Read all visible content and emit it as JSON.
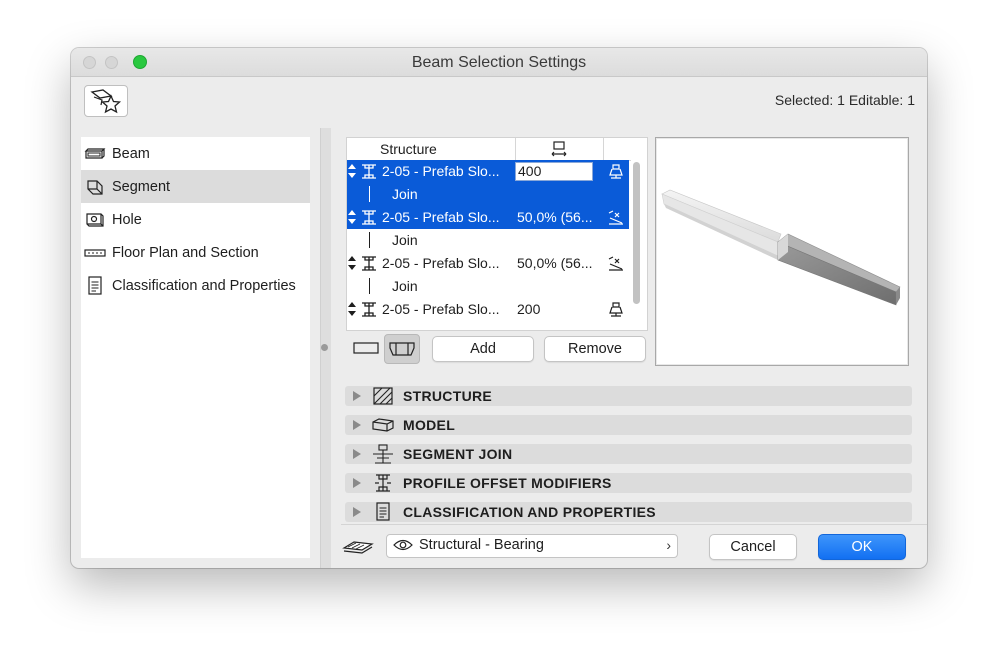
{
  "window": {
    "title": "Beam Selection Settings"
  },
  "header": {
    "selection_info": "Selected: 1 Editable: 1"
  },
  "sidebar": {
    "items": [
      {
        "label": "Beam",
        "icon": "beam-icon"
      },
      {
        "label": "Segment",
        "icon": "segment-icon",
        "selected": true
      },
      {
        "label": "Hole",
        "icon": "hole-icon"
      },
      {
        "label": "Floor Plan and Section",
        "icon": "floor-plan-icon"
      },
      {
        "label": "Classification and Properties",
        "icon": "classification-icon"
      }
    ]
  },
  "segments_table": {
    "columns": [
      "Structure",
      "",
      ""
    ],
    "rows": [
      {
        "type": "segment",
        "name": "2-05 - Prefab Slo...",
        "value": "400",
        "editing": true,
        "selected": true
      },
      {
        "type": "join",
        "label": "Join",
        "selected": true
      },
      {
        "type": "segment",
        "name": "2-05 - Prefab Slo...",
        "value": "50,0% (56...",
        "selected": true
      },
      {
        "type": "join",
        "label": "Join",
        "selected": false
      },
      {
        "type": "segment",
        "name": "2-05 - Prefab Slo...",
        "value": "50,0% (56...",
        "selected": false
      },
      {
        "type": "join",
        "label": "Join",
        "selected": false
      },
      {
        "type": "segment",
        "name": "2-05 - Prefab Slo...",
        "value": "200",
        "selected": false
      }
    ],
    "add_label": "Add",
    "remove_label": "Remove"
  },
  "sections": [
    {
      "label": "STRUCTURE",
      "icon": "hatch-icon"
    },
    {
      "label": "MODEL",
      "icon": "model-icon"
    },
    {
      "label": "SEGMENT JOIN",
      "icon": "segment-join-icon"
    },
    {
      "label": "PROFILE OFFSET MODIFIERS",
      "icon": "profile-offset-icon"
    },
    {
      "label": "CLASSIFICATION AND PROPERTIES",
      "icon": "classification-icon"
    }
  ],
  "footer": {
    "layer_value": "Structural - Bearing",
    "cancel_label": "Cancel",
    "ok_label": "OK"
  },
  "colors": {
    "selection": "#0a5bd8",
    "ok_button": "#1a78f5",
    "window_bg": "#ececec"
  }
}
